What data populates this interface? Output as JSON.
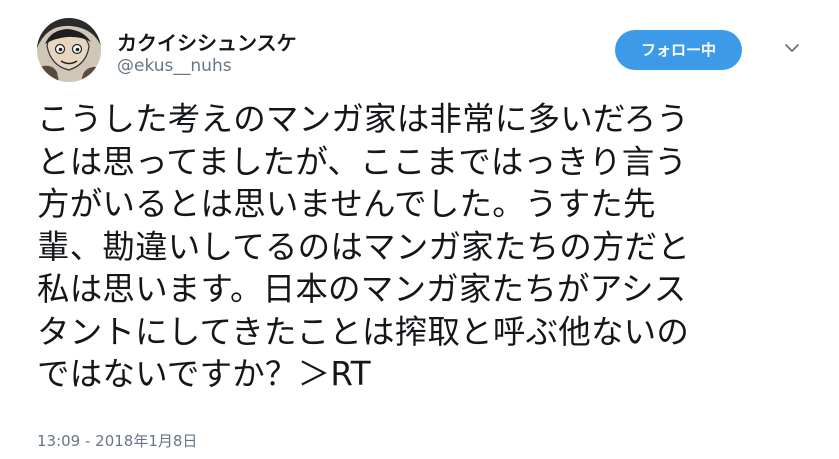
{
  "profile": {
    "display_name": "カクイシシュンスケ",
    "screen_name": "@ekus__nuhs"
  },
  "follow_button": {
    "label": "フォロー中"
  },
  "menu": {
    "icon": "chevron-down-icon"
  },
  "tweet": {
    "lines": [
      "こうした考えのマンガ家は非常に多いだろう",
      "とは思ってましたが、ここまではっきり言う",
      "方がいるとは思いませんでした。うすた先",
      "輩、勘違いしてるのはマンガ家たちの方だと",
      "私は思います。日本のマンガ家たちがアシス",
      "タントにしてきたことは搾取と呼ぶ他ないの",
      "ではないですか？＞RT"
    ],
    "timestamp": "13:09 - 2018年1月8日"
  },
  "colors": {
    "accent": "#3d9ae8",
    "text": "#14171a",
    "muted": "#657786"
  }
}
